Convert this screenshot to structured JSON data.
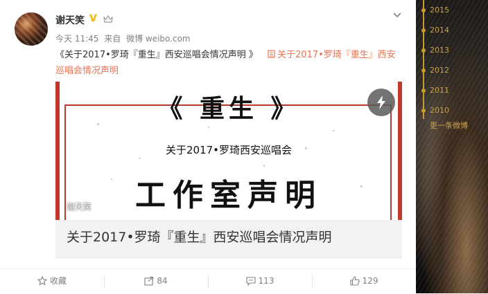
{
  "post": {
    "username": "谢天笑",
    "meta": {
      "time": "今天 11:45",
      "source_prefix": "来自",
      "source": "微博 weibo.com"
    },
    "text": "《关于2017•罗琦『重生』西安巡唱会情况声明 》",
    "link_icon": "article-icon",
    "link_text": "关于2017•罗琦『重生』西安巡唱会情况声明"
  },
  "card": {
    "poster_title": "《 重生 》",
    "poster_subtitle": "关于2017•罗琦西安巡唱会",
    "poster_heading": "工作室声明",
    "watermark": "谢天笑",
    "title": "关于2017•罗琦『重生』西安巡唱会情况声明"
  },
  "actions": {
    "favorite": "收藏",
    "repost": "84",
    "comment": "113",
    "like": "129"
  },
  "timeline": {
    "years": [
      "2015",
      "2014",
      "2013",
      "2012",
      "2011",
      "2010"
    ],
    "more": "更一条微博"
  },
  "colors": {
    "link": "#eb7350",
    "verified": "#f6b300",
    "poster_red": "#c0392b"
  }
}
